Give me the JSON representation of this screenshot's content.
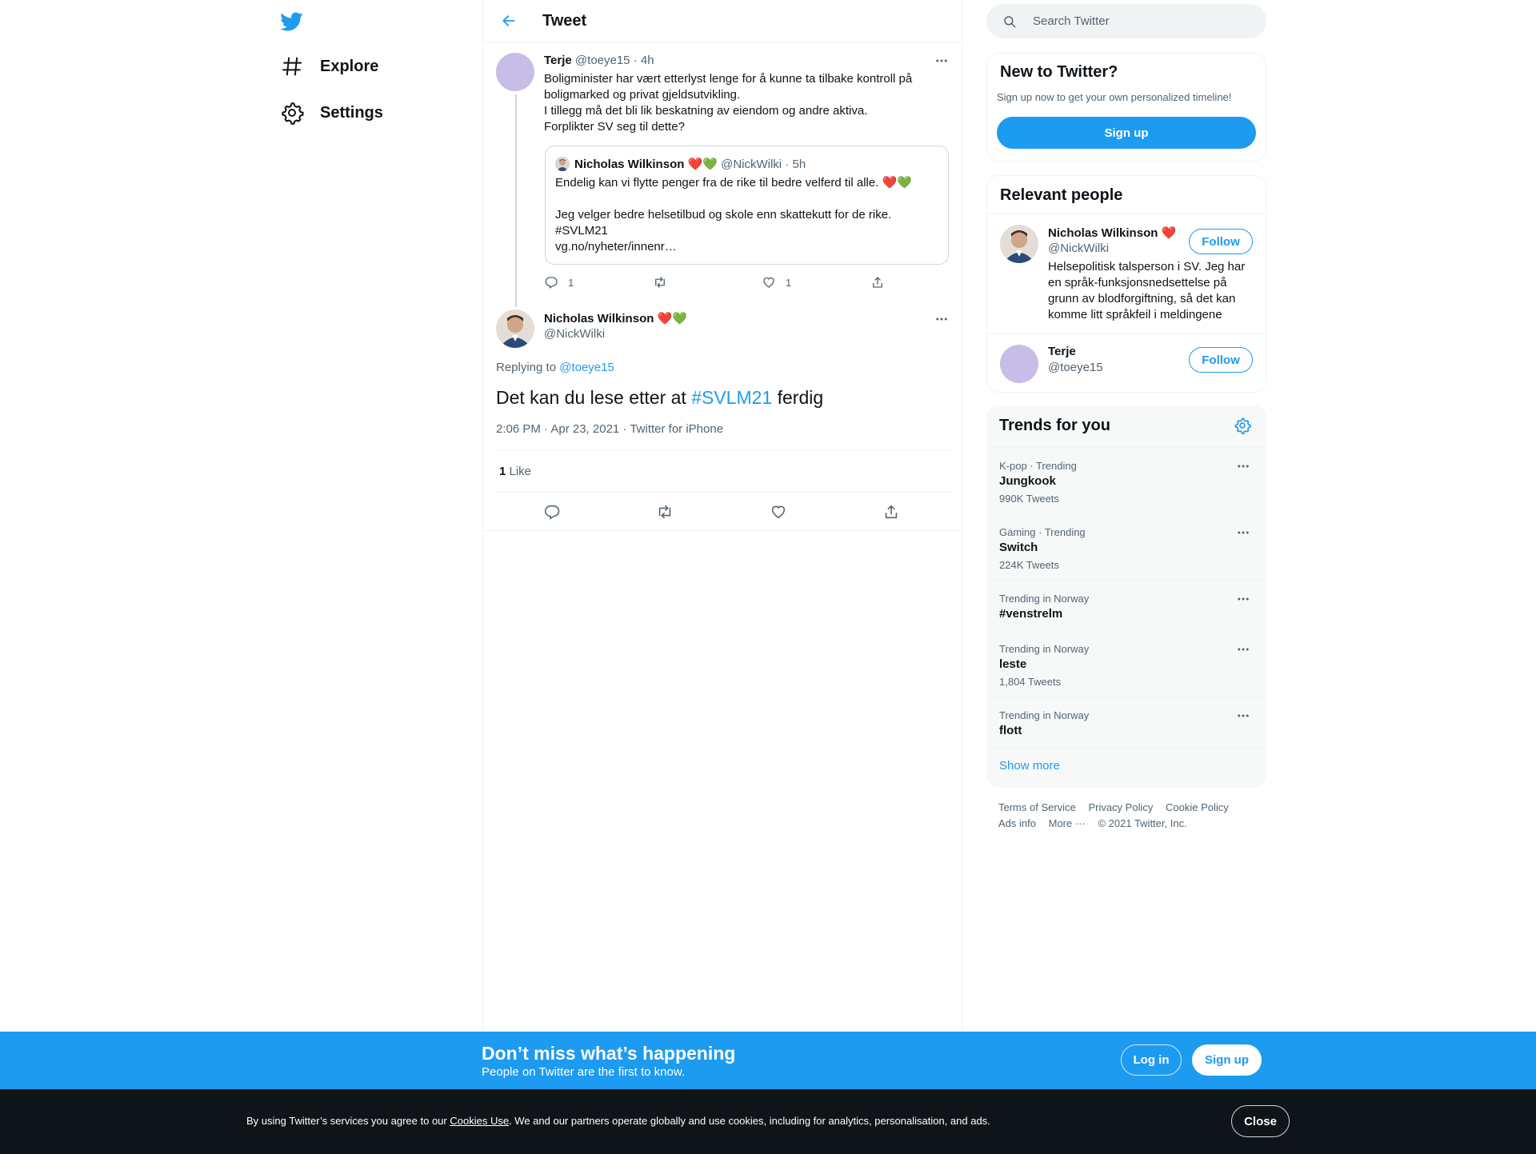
{
  "nav": {
    "explore_label": "Explore",
    "settings_label": "Settings"
  },
  "header": {
    "title": "Tweet"
  },
  "parent_tweet": {
    "name": "Terje",
    "handle": "@toeye15",
    "time": "· 4h",
    "text": "Boligminister har vært etterlyst lenge for å kunne ta tilbake kontroll på boligmarked og privat gjeldsutvikling.\nI tillegg må det bli lik beskatning av eiendom og andre aktiva.\nForplikter SV seg til dette?",
    "reply_count": "1",
    "like_count": "1",
    "quote": {
      "name": "Nicholas Wilkinson",
      "emoji": "❤️💚",
      "handle": "@NickWilki",
      "time": "· 5h",
      "text": "Endelig kan vi flytte penger fra de rike til bedre velferd til alle. ❤️💚\n\nJeg velger bedre helsetilbud og skole enn skattekutt for de rike.\n#SVLM21\nvg.no/nyheter/innenr…"
    }
  },
  "main_tweet": {
    "name": "Nicholas Wilkinson",
    "emoji": "❤️💚",
    "handle": "@NickWilki",
    "replying_prefix": "Replying to ",
    "replying_to": "@toeye15",
    "text_before": "Det kan du lese etter at ",
    "hashtag": "#SVLM21",
    "text_after": " ferdig",
    "meta": "2:06 PM · Apr 23, 2021 · Twitter for iPhone",
    "likes_count": "1",
    "likes_label": " Like"
  },
  "search": {
    "placeholder": "Search Twitter"
  },
  "new_to_twitter": {
    "title": "New to Twitter?",
    "subtitle": "Sign up now to get your own personalized timeline!",
    "button": "Sign up"
  },
  "relevant_people": {
    "title": "Relevant people",
    "people": [
      {
        "name": "Nicholas Wilkinson",
        "emoji": "❤️",
        "handle": "@NickWilki",
        "bio": "Helsepolitisk talsperson i SV. Jeg har en språk-funksjonsnedsettelse på grunn av blodforgiftning, så det kan komme litt språkfeil i meldingene",
        "button": "Follow"
      },
      {
        "name": "Terje",
        "handle": "@toeye15",
        "button": "Follow"
      }
    ]
  },
  "trends": {
    "title": "Trends for you",
    "items": [
      {
        "context": "K-pop · Trending",
        "name": "Jungkook",
        "count": "990K Tweets"
      },
      {
        "context": "Gaming · Trending",
        "name": "Switch",
        "count": "224K Tweets"
      },
      {
        "context": "Trending in Norway",
        "name": "#venstrelm",
        "count": ""
      },
      {
        "context": "Trending in Norway",
        "name": "leste",
        "count": "1,804 Tweets"
      },
      {
        "context": "Trending in Norway",
        "name": "flott",
        "count": ""
      }
    ],
    "show_more": "Show more"
  },
  "footer": {
    "terms": "Terms of Service",
    "privacy": "Privacy Policy",
    "cookie": "Cookie Policy",
    "ads": "Ads info",
    "more": "More ···",
    "copyright": "© 2021 Twitter, Inc."
  },
  "banner": {
    "title": "Don’t miss what’s happening",
    "subtitle": "People on Twitter are the first to know.",
    "login": "Log in",
    "signup": "Sign up"
  },
  "cookie_bar": {
    "text_before": "By using Twitter’s services you agree to our ",
    "link": "Cookies Use",
    "text_after": ". We and our partners operate globally and use cookies, including for analytics, personalisation, and ads.",
    "close": "Close"
  },
  "colors": {
    "accent": "#1d9bf0",
    "text": "#0f1419",
    "secondary": "#536471",
    "border": "#eff3f4",
    "cookie_bg": "#0f1419"
  },
  "icons": [
    "twitter-bird-icon",
    "hashtag-icon",
    "gear-icon",
    "back-arrow-icon",
    "more-icon",
    "reply-icon",
    "retweet-icon",
    "heart-icon",
    "share-icon",
    "search-icon"
  ]
}
